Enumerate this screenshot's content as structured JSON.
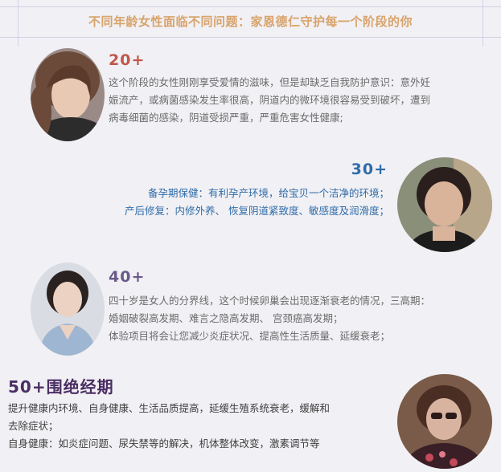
{
  "header": {
    "title": "不同年龄女性面临不同问题：家恩德仁守护每一个阶段的你"
  },
  "sections": [
    {
      "age": "20+",
      "lines": [
        "这个阶段的女性刚刚享受爱情的滋味，但是却缺乏自我防护意识：意外妊",
        "娠流产，或病菌感染发生率很高，阴道内的微环境很容易受到破坏，遭到",
        "病毒细菌的感染，阴道受损严重，严重危害女性健康;"
      ]
    },
    {
      "age": "30+",
      "lines": [
        "备孕期保健：有利孕产环境，给宝贝一个洁净的环境；",
        "产后修复：内修外养、 恢复阴道紧致度、敏感度及润滑度；"
      ]
    },
    {
      "age": "40+",
      "lines": [
        "四十岁是女人的分界线，这个时候卵巢会出现逐渐衰老的情况，三高期：",
        "婚姻破裂高发期、难言之隐高发期、 宫颈癌高发期；",
        "体验项目将会让您减少炎症状况、提高性生活质量、延缓衰老；"
      ]
    },
    {
      "age": "50+围绝经期",
      "lines": [
        "提升健康内环境、自身健康、生活品质提高，延缓生殖系统衰老，缓解和",
        "去除症状；",
        "自身健康：如炎症问题、尿失禁等的解决，机体整体改变，激素调节等"
      ]
    }
  ],
  "colors": {
    "header": "#d8a36b",
    "age20": "#c0574b",
    "age30": "#2f6ca8",
    "age40": "#6a5a8a",
    "age50": "#4b2e63",
    "background": "#f1f0f4"
  }
}
